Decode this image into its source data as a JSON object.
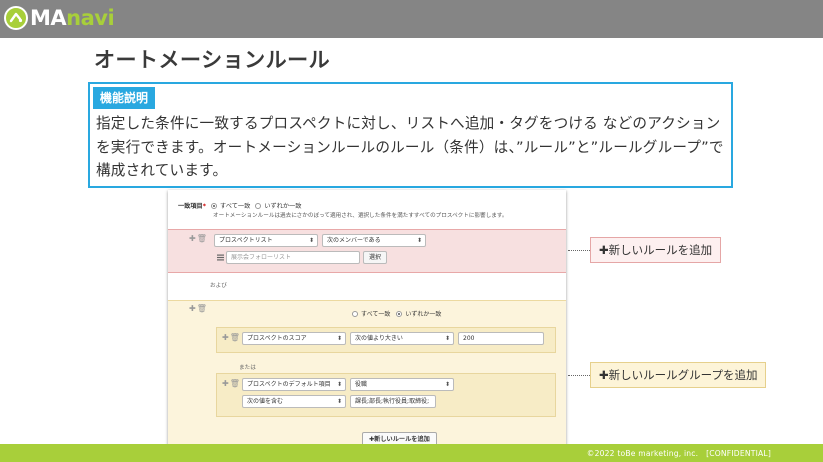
{
  "header": {
    "logo_text_prefix": "MA",
    "logo_text_suffix": "navi"
  },
  "page": {
    "title": "オートメーションルール"
  },
  "description": {
    "tag": "機能説明",
    "text": "指定した条件に一致するプロスペクトに対し、リストへ追加・タグをつける などのアクションを実行できます。オートメーションルールのルール（条件）は、”ルール”と”ルールグループ”で構成されています。"
  },
  "panel": {
    "match_label": "一致項目",
    "match_options": [
      "すべて一致",
      "いずれか一致"
    ],
    "match_selected": 0,
    "match_note": "オートメーションルールは過去にさかのぼって適用され、選択した条件を満たすすべてのプロスペクトに影響します。",
    "rule1": {
      "field": "プロスペクトリスト",
      "operator": "次のメンバーである",
      "list_placeholder": "展示会フォローリスト",
      "select_button": "選択"
    },
    "and_label": "および",
    "group": {
      "match_options": [
        "すべて一致",
        "いずれか一致"
      ],
      "match_selected": 1,
      "rule_a": {
        "field": "プロスペクトのスコア",
        "operator": "次の値より大きい",
        "value": "200"
      },
      "or_label": "または",
      "rule_b": {
        "field": "プロスペクトのデフォルト項目",
        "sub_field": "役職",
        "operator": "次の値を含む",
        "value": "課長;部長;執行役員;取締役;"
      },
      "add_rule_button": "✚新しいルールを追加"
    }
  },
  "callouts": {
    "add_rule": "✚新しいルールを追加",
    "add_group": "✚新しいルールグループを追加"
  },
  "footer": {
    "copyright": "©2022 toBe marketing, inc.　[CONFIDENTIAL]"
  },
  "colors": {
    "topbar": "#858585",
    "accent_green": "#a8cf3a",
    "accent_blue": "#29a8e0",
    "rule_pink": "#f7e0e0",
    "group_yellow": "#fcf4dc"
  }
}
